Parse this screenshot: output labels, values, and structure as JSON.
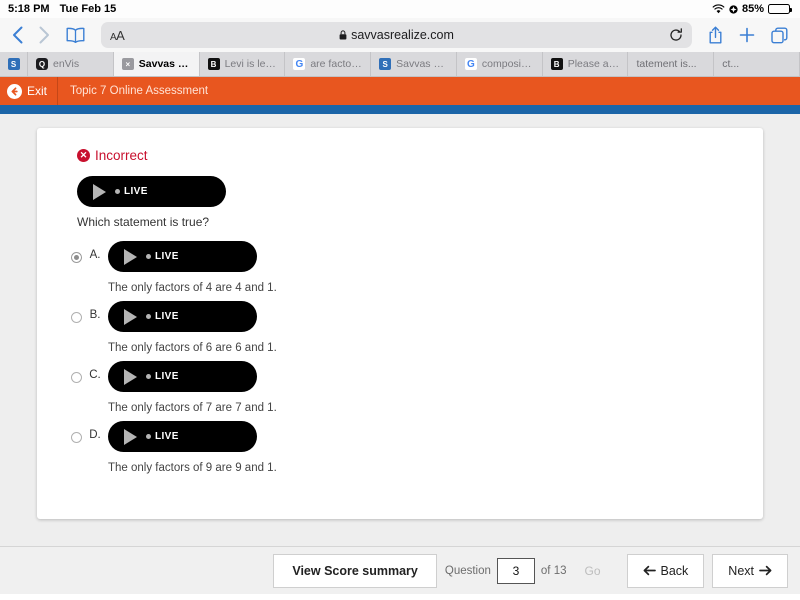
{
  "status_bar": {
    "time": "5:18 PM",
    "date": "Tue Feb 15",
    "wifi_icon": "wifi-icon",
    "location_icon": "location-icon",
    "battery_percent": "85%",
    "battery_level": 85
  },
  "browser": {
    "back_icon": "chevron-left-icon",
    "forward_icon": "chevron-right-icon",
    "bookmarks_icon": "book-icon",
    "text_size_label": "AA",
    "lock_icon": "lock-icon",
    "url": "savvasrealize.com",
    "reload_icon": "reload-icon",
    "share_icon": "share-icon",
    "new_tab_icon": "plus-icon",
    "tab_overview_icon": "tabs-icon",
    "tabs": [
      {
        "label": "",
        "favicon": "savvas-icon",
        "favicon_text": "S",
        "active": false
      },
      {
        "label": "enVis",
        "favicon": "envision-icon",
        "favicon_text": "Q",
        "active": false
      },
      {
        "label": "Savvas Realize",
        "favicon": "close-icon",
        "favicon_text": "×",
        "active": true
      },
      {
        "label": "Levi is learni...",
        "favicon": "brainly-icon",
        "favicon_text": "B",
        "active": false
      },
      {
        "label": "are factor pa...",
        "favicon": "google-icon",
        "favicon_text": "G",
        "active": false
      },
      {
        "label": "Savvas Realize",
        "favicon": "savvas-icon",
        "favicon_text": "S",
        "active": false
      },
      {
        "label": "composite n...",
        "favicon": "google-icon",
        "favicon_text": "G",
        "active": false
      },
      {
        "label": "Please answ...",
        "favicon": "brainly-icon",
        "favicon_text": "B",
        "active": false
      },
      {
        "label": "tatement is...",
        "favicon": "",
        "favicon_text": "",
        "active": false
      },
      {
        "label": "ct...",
        "favicon": "",
        "favicon_text": "",
        "active": false
      }
    ]
  },
  "app_header": {
    "exit_label": "Exit",
    "exit_icon": "back-arrow-circle-icon",
    "assessment_title": "Topic 7 Online Assessment",
    "accent_color": "#e8561f",
    "secondary_color": "#1b65a8"
  },
  "question": {
    "status_label": "Incorrect",
    "status_icon": "error-x-circle-icon",
    "status_color": "#c8102e",
    "audio_label": "LIVE",
    "play_icon": "play-icon",
    "prompt": "Which statement is true?",
    "options": [
      {
        "letter": "A.",
        "audio_label": "LIVE",
        "text": "The only factors of 4 are 4 and 1.",
        "selected": true
      },
      {
        "letter": "B.",
        "audio_label": "LIVE",
        "text": "The only factors of 6 are 6 and 1.",
        "selected": false
      },
      {
        "letter": "C.",
        "audio_label": "LIVE",
        "text": "The only factors of 7 are 7 and 1.",
        "selected": false
      },
      {
        "letter": "D.",
        "audio_label": "LIVE",
        "text": "The only factors of 9 are 9 and 1.",
        "selected": false
      }
    ]
  },
  "bottom_nav": {
    "score_summary_label": "View Score summary",
    "question_label": "Question",
    "question_number": "3",
    "of_label": "of 13",
    "go_label": "Go",
    "back_label": "Back",
    "back_icon": "arrow-left-icon",
    "next_label": "Next",
    "next_icon": "arrow-right-icon"
  }
}
